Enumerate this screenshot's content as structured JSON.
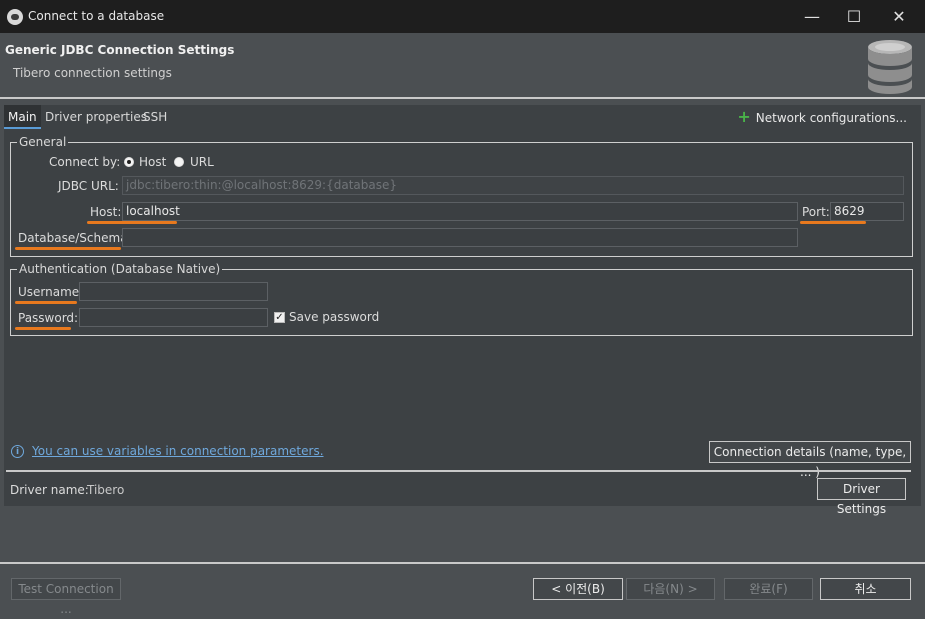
{
  "window": {
    "title": "Connect to a database",
    "minimize_glyph": "—",
    "maximize_glyph": "☐",
    "close_glyph": "✕"
  },
  "header": {
    "title": "Generic JDBC Connection Settings",
    "subtitle": "Tibero connection settings"
  },
  "tabs": [
    "Main",
    "Driver properties",
    "SSH"
  ],
  "network_config_label": "Network configurations...",
  "general": {
    "legend": "General",
    "connect_by_label": "Connect by:",
    "option_host": "Host",
    "option_url": "URL",
    "selected": "Host",
    "jdbc_url_label": "JDBC URL:",
    "jdbc_url_value": "jdbc:tibero:thin:@localhost:8629:{database}",
    "host_label": "Host:",
    "host_value": "localhost",
    "port_label": "Port:",
    "port_value": "8629",
    "database_label": "Database/Schema:",
    "database_value": ""
  },
  "auth": {
    "legend": "Authentication (Database Native)",
    "username_label": "Username:",
    "username_value": "",
    "password_label": "Password:",
    "password_value": "",
    "save_password_label": "Save password",
    "save_password_checked": true
  },
  "info": {
    "icon_glyph": "i",
    "link_text": "You can use variables in connection parameters."
  },
  "connection_details_label": "Connection details (name, type, ... )",
  "driver": {
    "label": "Driver name:",
    "value": "Tibero",
    "settings_label": "Driver Settings"
  },
  "footer": {
    "test_connection": "Test Connection ...",
    "back": "< 이전(B)",
    "next": "다음(N) >",
    "finish": "완료(F)",
    "cancel": "취소"
  },
  "colors": {
    "annotation_underline": "#e8791e",
    "link": "#6fa8dc",
    "plus_icon": "#49b249"
  }
}
